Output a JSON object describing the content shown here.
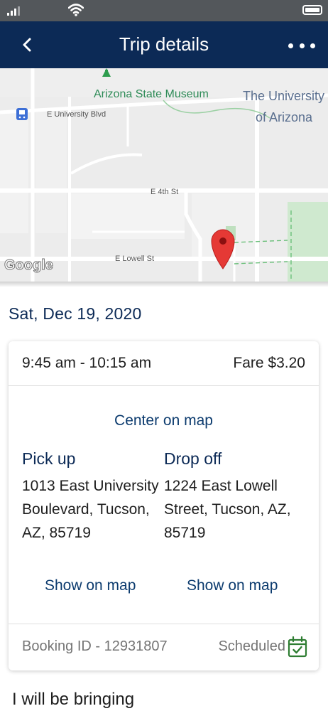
{
  "status_bar": {
    "signal_icon": "signal-icon",
    "wifi_icon": "wifi-icon",
    "battery_icon": "battery-icon"
  },
  "header": {
    "title": "Trip details",
    "back_icon": "chevron-left-icon",
    "menu_icon": "more-horizontal-icon"
  },
  "map": {
    "labels": {
      "museum": "Arizona State Museum",
      "university_line1": "The University",
      "university_line2": "of Arizona",
      "e_university_blvd": "E University Blvd",
      "e_4th_st": "E 4th St",
      "e_lowell_st": "E Lowell St",
      "attribution": "Google"
    },
    "pin_color": "#e53935"
  },
  "trip": {
    "date": "Sat, Dec 19, 2020",
    "time_range": "9:45 am - 10:15 am",
    "fare": "Fare $3.20",
    "center_on_map": "Center on map",
    "pickup": {
      "title": "Pick up",
      "address_lines": [
        "1013 East University",
        "Boulevard, Tucson,",
        "AZ, 85719"
      ],
      "show_on_map": "Show on map"
    },
    "dropoff": {
      "title": "Drop off",
      "address_lines": [
        "1224 East Lowell",
        "Street, Tucson, AZ,",
        "85719"
      ],
      "show_on_map": "Show on map"
    },
    "booking_id": "Booking ID - 12931807",
    "status": "Scheduled",
    "status_color": "#2e7d32"
  },
  "section": {
    "bringing_heading": "I will be bringing"
  },
  "colors": {
    "header_bg": "#0c2a56",
    "accent_text": "#0c2a56",
    "link": "#0c3b6e"
  }
}
